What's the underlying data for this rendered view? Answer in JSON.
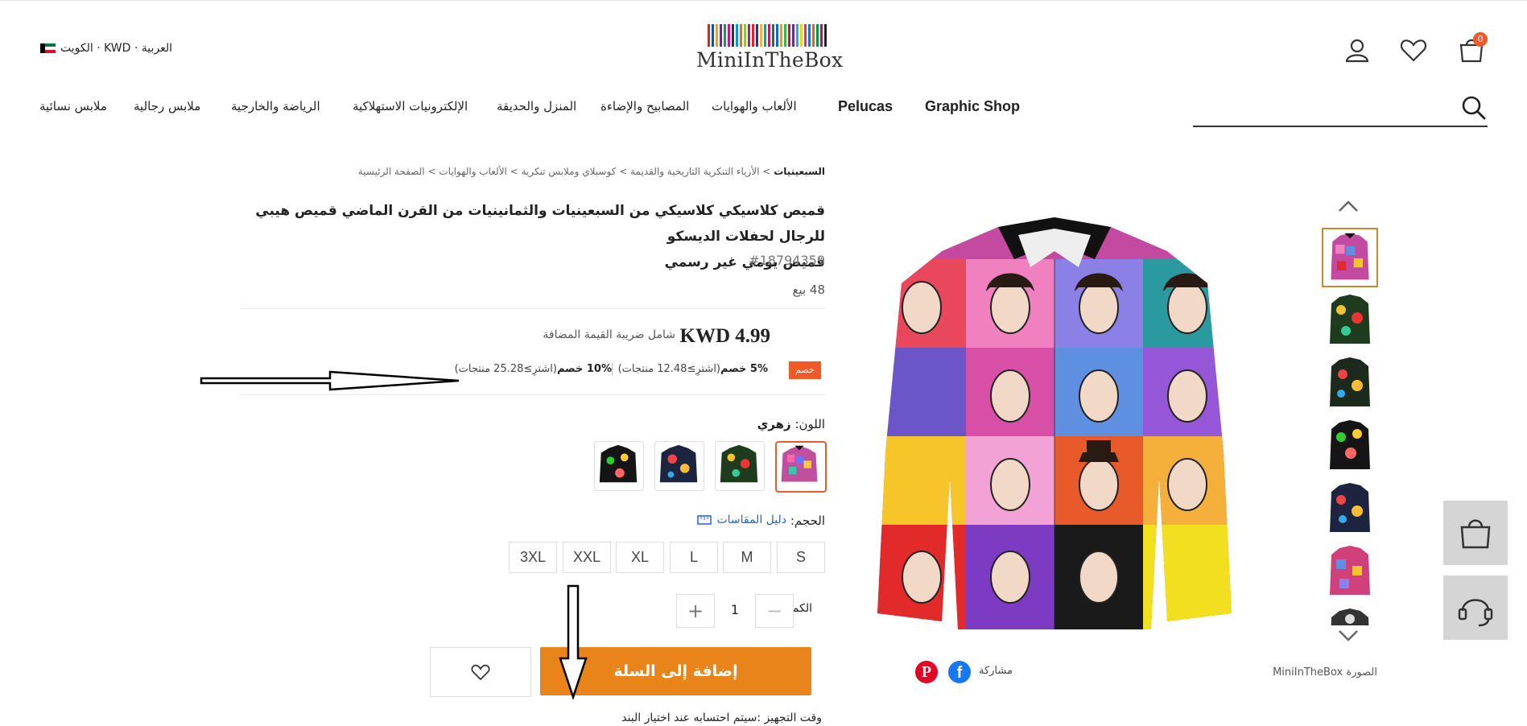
{
  "header": {
    "locale_text": "العربية · KWD · الكويت",
    "logo_text": "MiniInTheBox",
    "cart_count": "0",
    "brand_stripes": [
      "#e2231a",
      "#1f4e9c",
      "#f4a300",
      "#6a2c91",
      "#00a651",
      "#ec008c",
      "#333333",
      "#0099d8",
      "#f26522",
      "#8dc63f",
      "#92278f",
      "#ed1c24",
      "#2e3192",
      "#fbb040",
      "#00a99d",
      "#c2185b",
      "#555555",
      "#0072bc",
      "#f7941d",
      "#39b54a",
      "#be1e2d",
      "#662d91",
      "#27aae1",
      "#d7df23",
      "#ee2a7b",
      "#1c75bc",
      "#f15a29",
      "#009444",
      "#9e1f63",
      "#231f20"
    ]
  },
  "nav": {
    "items": [
      "ملابس نسائية",
      "ملابس رجالية",
      "الرياضة والخارجية",
      "الإلكترونيات الاستهلاكية",
      "المنزل والحديقة",
      "المصابيح والإضاءة",
      "الألعاب والهوايات"
    ],
    "latin": [
      "Pelucas",
      "Graphic Shop"
    ]
  },
  "breadcrumb": {
    "home": "الصفحة الرئيسية",
    "c1": "الألعاب والهوايات",
    "c2": "كوسبلاي وملابس تنكرية",
    "c3": "الأزياء التنكرية التاريخية والقديمة",
    "current": "السبعينيات",
    "sep": ">"
  },
  "product": {
    "title_line1": "قميص كلاسيكي كلاسيكي من السبعينيات والثمانينيات من القرن الماضي قميص هيبي للرجال لحفلات الديسكو",
    "title_line2": "قميص يومي غير رسمي",
    "sku": "#18794359",
    "sold": "48 بيع",
    "price": "KWD 4.99",
    "vat": "شامل ضريبة القيمة المضافة",
    "discount_badge": "خصم",
    "tier1": "5% خصم",
    "tier1_note": "(اشترِ≥12.48 منتجات)",
    "tier2": "10% خصم",
    "tier2_note": "(اشترِ≥25.28 منتجات)",
    "color_label": "اللون:",
    "color_value": "زهري",
    "size_label": "الحجم:",
    "size_guide": "دليل المقاسات",
    "sizes": [
      "S",
      "M",
      "L",
      "XL",
      "XXL",
      "3XL"
    ],
    "qty_label": "الكمية",
    "qty_minus": "−",
    "qty_value": "1",
    "qty_plus": "+",
    "add_to_cart": "إضافة إلى السلة",
    "prep_time": "وقت التجهيز :سيتم احتسابه عند اختيار البند"
  },
  "gallery": {
    "credit": "الصورة MiniInTheBox",
    "share": "مشاركة",
    "facebook": "f",
    "pinterest": "P"
  },
  "colors": {
    "accent": "#f05a28",
    "button": "#e8841a",
    "link": "#2563c9"
  }
}
